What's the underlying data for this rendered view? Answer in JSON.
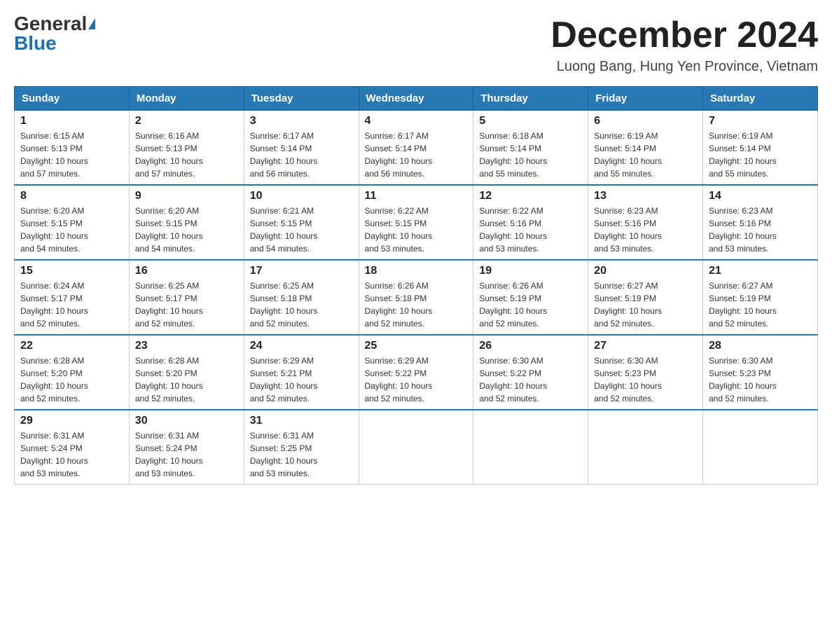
{
  "header": {
    "logo_general": "General",
    "logo_blue": "Blue",
    "month_title": "December 2024",
    "location": "Luong Bang, Hung Yen Province, Vietnam"
  },
  "weekdays": [
    "Sunday",
    "Monday",
    "Tuesday",
    "Wednesday",
    "Thursday",
    "Friday",
    "Saturday"
  ],
  "weeks": [
    [
      {
        "day": "1",
        "sunrise": "6:15 AM",
        "sunset": "5:13 PM",
        "daylight": "10 hours and 57 minutes."
      },
      {
        "day": "2",
        "sunrise": "6:16 AM",
        "sunset": "5:13 PM",
        "daylight": "10 hours and 57 minutes."
      },
      {
        "day": "3",
        "sunrise": "6:17 AM",
        "sunset": "5:14 PM",
        "daylight": "10 hours and 56 minutes."
      },
      {
        "day": "4",
        "sunrise": "6:17 AM",
        "sunset": "5:14 PM",
        "daylight": "10 hours and 56 minutes."
      },
      {
        "day": "5",
        "sunrise": "6:18 AM",
        "sunset": "5:14 PM",
        "daylight": "10 hours and 55 minutes."
      },
      {
        "day": "6",
        "sunrise": "6:19 AM",
        "sunset": "5:14 PM",
        "daylight": "10 hours and 55 minutes."
      },
      {
        "day": "7",
        "sunrise": "6:19 AM",
        "sunset": "5:14 PM",
        "daylight": "10 hours and 55 minutes."
      }
    ],
    [
      {
        "day": "8",
        "sunrise": "6:20 AM",
        "sunset": "5:15 PM",
        "daylight": "10 hours and 54 minutes."
      },
      {
        "day": "9",
        "sunrise": "6:20 AM",
        "sunset": "5:15 PM",
        "daylight": "10 hours and 54 minutes."
      },
      {
        "day": "10",
        "sunrise": "6:21 AM",
        "sunset": "5:15 PM",
        "daylight": "10 hours and 54 minutes."
      },
      {
        "day": "11",
        "sunrise": "6:22 AM",
        "sunset": "5:15 PM",
        "daylight": "10 hours and 53 minutes."
      },
      {
        "day": "12",
        "sunrise": "6:22 AM",
        "sunset": "5:16 PM",
        "daylight": "10 hours and 53 minutes."
      },
      {
        "day": "13",
        "sunrise": "6:23 AM",
        "sunset": "5:16 PM",
        "daylight": "10 hours and 53 minutes."
      },
      {
        "day": "14",
        "sunrise": "6:23 AM",
        "sunset": "5:16 PM",
        "daylight": "10 hours and 53 minutes."
      }
    ],
    [
      {
        "day": "15",
        "sunrise": "6:24 AM",
        "sunset": "5:17 PM",
        "daylight": "10 hours and 52 minutes."
      },
      {
        "day": "16",
        "sunrise": "6:25 AM",
        "sunset": "5:17 PM",
        "daylight": "10 hours and 52 minutes."
      },
      {
        "day": "17",
        "sunrise": "6:25 AM",
        "sunset": "5:18 PM",
        "daylight": "10 hours and 52 minutes."
      },
      {
        "day": "18",
        "sunrise": "6:26 AM",
        "sunset": "5:18 PM",
        "daylight": "10 hours and 52 minutes."
      },
      {
        "day": "19",
        "sunrise": "6:26 AM",
        "sunset": "5:19 PM",
        "daylight": "10 hours and 52 minutes."
      },
      {
        "day": "20",
        "sunrise": "6:27 AM",
        "sunset": "5:19 PM",
        "daylight": "10 hours and 52 minutes."
      },
      {
        "day": "21",
        "sunrise": "6:27 AM",
        "sunset": "5:19 PM",
        "daylight": "10 hours and 52 minutes."
      }
    ],
    [
      {
        "day": "22",
        "sunrise": "6:28 AM",
        "sunset": "5:20 PM",
        "daylight": "10 hours and 52 minutes."
      },
      {
        "day": "23",
        "sunrise": "6:28 AM",
        "sunset": "5:20 PM",
        "daylight": "10 hours and 52 minutes."
      },
      {
        "day": "24",
        "sunrise": "6:29 AM",
        "sunset": "5:21 PM",
        "daylight": "10 hours and 52 minutes."
      },
      {
        "day": "25",
        "sunrise": "6:29 AM",
        "sunset": "5:22 PM",
        "daylight": "10 hours and 52 minutes."
      },
      {
        "day": "26",
        "sunrise": "6:30 AM",
        "sunset": "5:22 PM",
        "daylight": "10 hours and 52 minutes."
      },
      {
        "day": "27",
        "sunrise": "6:30 AM",
        "sunset": "5:23 PM",
        "daylight": "10 hours and 52 minutes."
      },
      {
        "day": "28",
        "sunrise": "6:30 AM",
        "sunset": "5:23 PM",
        "daylight": "10 hours and 52 minutes."
      }
    ],
    [
      {
        "day": "29",
        "sunrise": "6:31 AM",
        "sunset": "5:24 PM",
        "daylight": "10 hours and 53 minutes."
      },
      {
        "day": "30",
        "sunrise": "6:31 AM",
        "sunset": "5:24 PM",
        "daylight": "10 hours and 53 minutes."
      },
      {
        "day": "31",
        "sunrise": "6:31 AM",
        "sunset": "5:25 PM",
        "daylight": "10 hours and 53 minutes."
      },
      null,
      null,
      null,
      null
    ]
  ]
}
